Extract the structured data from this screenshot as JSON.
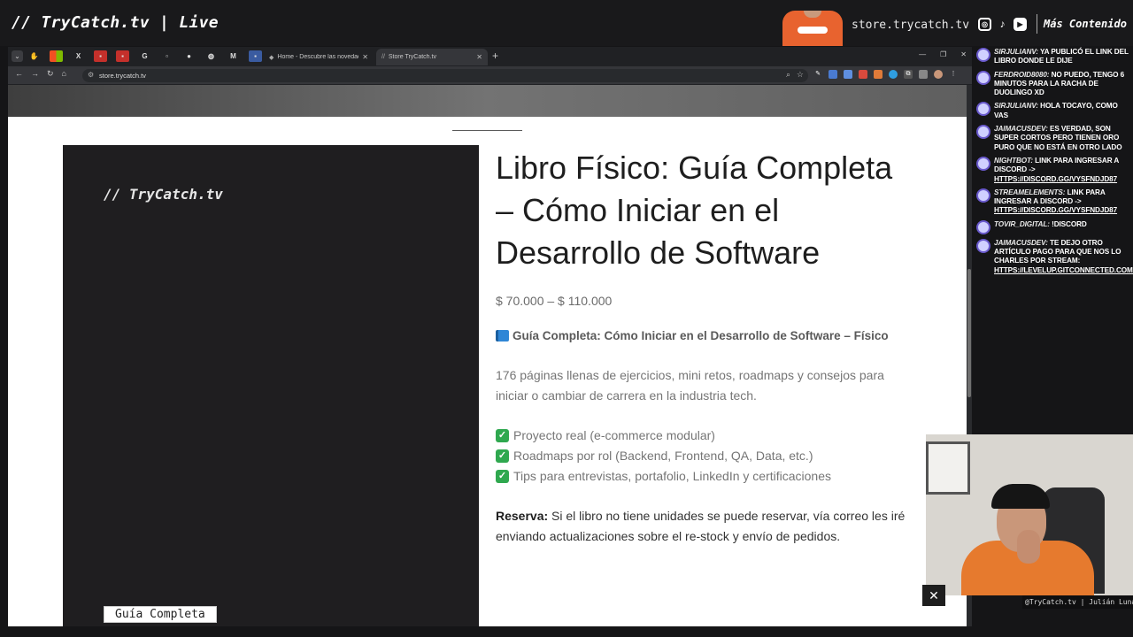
{
  "stream": {
    "title": "// TryCatch.tv | Live",
    "store_url": "store.trycatch.tv",
    "more_label": "Más Contenido",
    "webcam_caption": "@TryCatch.tv | Julián Luna"
  },
  "browser": {
    "tabs": [
      {
        "title": "Home - Descubre las novedades"
      },
      {
        "title": "Store TryCatch.tv",
        "favicon": "//"
      }
    ],
    "address": "store.trycatch.tv"
  },
  "product": {
    "cover_brand": "// TryCatch.tv",
    "cover_tag": "Guía Completa",
    "title": "Libro Físico: Guía Completa – Cómo Iniciar en el Desarrollo de Software",
    "price": "$ 70.000 – $ 110.000",
    "subtitle": "Guía Completa: Cómo Iniciar en el Desarrollo de Software – Físico",
    "description": "176 páginas llenas de ejercicios, mini retos, roadmaps y consejos para iniciar o cambiar de carrera en la industria tech.",
    "features": [
      "Proyecto real (e-commerce modular)",
      "Roadmaps por rol (Backend, Frontend, QA, Data, etc.)",
      "Tips para entrevistas, portafolio, LinkedIn y certificaciones"
    ],
    "reserve_label": "Reserva:",
    "reserve_text": " Si el libro no tiene unidades se puede reservar, vía correo les iré enviando actualizaciones sobre el re-stock y envío de pedidos."
  },
  "chat": {
    "messages": [
      {
        "user": "sirjulianv:",
        "text": " ya publicó el link del libro donde le dije"
      },
      {
        "user": "ferdroid8080:",
        "text": " no puedo, tengo 6 minutos para la racha de duolingo xD"
      },
      {
        "user": "sirjulianv:",
        "text": " hola tocayo, como vas"
      },
      {
        "user": "jaimacusdev:",
        "text": " es verdad, son super cortos pero tienen oro puro que no está en otro lado"
      },
      {
        "user": "nightbot:",
        "text": " Link para ingresar a Discord -> ",
        "link": "https://discord.gg/vysFNDJD87"
      },
      {
        "user": "streamelements:",
        "text": " Link para ingresar a Discord -> ",
        "link": "https://discord.gg/vysFNDJD87"
      },
      {
        "user": "tovir_digital:",
        "text": " !discord"
      },
      {
        "user": "jaimacusdev:",
        "text": " te dejo otro artículo pago para que nos lo charles por stream: ",
        "link": "https://levelup.gitconnected.com/i-"
      }
    ]
  }
}
